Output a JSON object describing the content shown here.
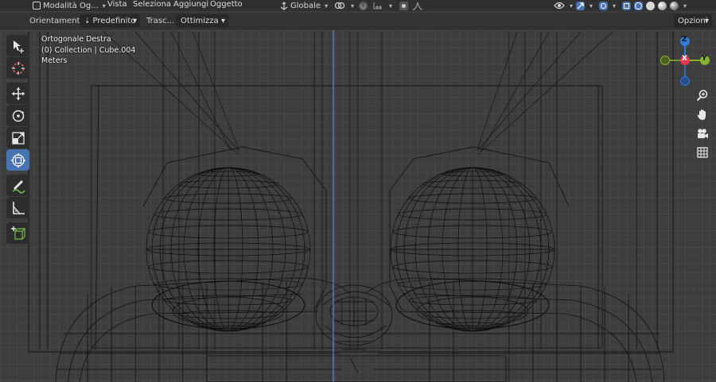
{
  "header": {
    "mode_label": "Modalità Og...",
    "menus": [
      "Vista",
      "Seleziona",
      "Aggiungi",
      "Oggetto"
    ],
    "orientation_dropdown": "Globale"
  },
  "toolbar": {
    "orientation_label": "Orientamento:",
    "orientation_value": "Predefinito",
    "drag_label": "Trasc...",
    "drag_value": "Ottimizza",
    "options_label": "Opzioni"
  },
  "viewport": {
    "view_name": "Ortogonale Destra",
    "collection": "(0) Collection | Cube.004",
    "units": "Meters",
    "gizmo_axes": {
      "z": "Z",
      "x": "X",
      "y": "Y"
    },
    "colors": {
      "x_axis": "#e8394f",
      "y_axis": "#86b52c",
      "z_axis": "#2f7ddf",
      "wire": "#0c0c0c",
      "vertical_line": "#4a90e0"
    }
  },
  "left_tools": [
    {
      "name": "select-tool",
      "icon": "select-cursor-icon"
    },
    {
      "name": "cursor-tool",
      "icon": "cursor-3d-icon"
    },
    {
      "name": "move-tool",
      "icon": "move-icon"
    },
    {
      "name": "rotate-tool",
      "icon": "rotate-icon"
    },
    {
      "name": "scale-tool",
      "icon": "scale-icon"
    },
    {
      "name": "transform-tool",
      "icon": "transform-icon",
      "active": true
    },
    {
      "name": "annotate-tool",
      "icon": "annotate-icon"
    },
    {
      "name": "measure-tool",
      "icon": "measure-icon"
    },
    {
      "name": "add-cube-tool",
      "icon": "add-cube-icon"
    }
  ],
  "right_nav": [
    "zoom-icon",
    "hand-pan-icon",
    "camera-icon",
    "grid-icon"
  ]
}
